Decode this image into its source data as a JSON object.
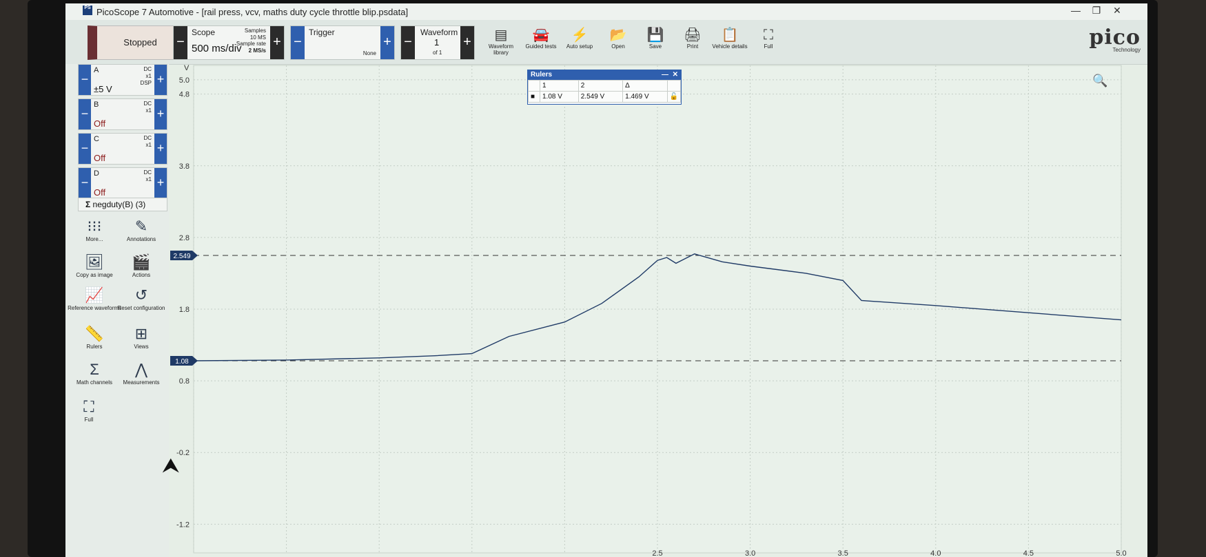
{
  "window": {
    "app_icon": "PS",
    "title": "PicoScope 7 Automotive - [rail press, vcv, maths duty cycle throttle blip.psdata]",
    "min_icon": "minimize-icon",
    "restore_icon": "restore-icon",
    "close_icon": "close-icon"
  },
  "toolbar": {
    "run_state": "Stopped",
    "scope": {
      "label": "Scope",
      "timebase": "500 ms/div",
      "samples_label": "Samples",
      "samples_value": "10 MS",
      "rate_label": "Sample rate",
      "rate_value": "2 MS/s"
    },
    "trigger": {
      "label": "Trigger",
      "mode": "None"
    },
    "waveform": {
      "label": "Waveform",
      "index": "1",
      "of": "of 1"
    },
    "buttons": [
      {
        "label": "Waveform library",
        "icon": "waveform-library-icon"
      },
      {
        "label": "Guided tests",
        "icon": "car-icon"
      },
      {
        "label": "Auto setup",
        "icon": "magic-wand-icon"
      },
      {
        "label": "Open",
        "icon": "folder-icon"
      },
      {
        "label": "Save",
        "icon": "save-icon"
      },
      {
        "label": "Print",
        "icon": "printer-icon"
      },
      {
        "label": "Vehicle details",
        "icon": "clipboard-icon"
      },
      {
        "label": "Full",
        "icon": "fullscreen-icon"
      }
    ],
    "brand": {
      "word": "pico",
      "sub": "Technology"
    }
  },
  "channels": [
    {
      "name": "A",
      "value": "±5 V",
      "coupling": "DC",
      "probe": "x1",
      "extra": "DSP",
      "color": "#111111"
    },
    {
      "name": "B",
      "value": "Off",
      "coupling": "DC",
      "probe": "x1",
      "extra": "",
      "color": "#8b1a1a"
    },
    {
      "name": "C",
      "value": "Off",
      "coupling": "DC",
      "probe": "x1",
      "extra": "",
      "color": "#8b1a1a"
    },
    {
      "name": "D",
      "value": "Off",
      "coupling": "DC",
      "probe": "x1",
      "extra": "",
      "color": "#8b1a1a"
    }
  ],
  "math_channel": {
    "symbol": "Σ",
    "label": "negduty(B) (3)"
  },
  "side_buttons": [
    {
      "label": "More...",
      "icon": "dots-grid-icon"
    },
    {
      "label": "Annotations",
      "icon": "annotations-icon"
    },
    {
      "label": "Copy as image",
      "icon": "image-icon"
    },
    {
      "label": "Actions",
      "icon": "clapperboard-icon"
    },
    {
      "label": "Reference waveforms",
      "icon": "reference-waveform-icon"
    },
    {
      "label": "Reset configuration",
      "icon": "reset-icon"
    },
    {
      "label": "Rulers",
      "icon": "ruler-icon"
    },
    {
      "label": "Views",
      "icon": "grid-view-icon"
    },
    {
      "label": "Math channels",
      "icon": "sigma-icon"
    },
    {
      "label": "Measurements",
      "icon": "calipers-icon"
    },
    {
      "label": "Full",
      "icon": "fullscreen-icon"
    }
  ],
  "rulers": {
    "title": "Rulers",
    "col1": "1",
    "col2": "2",
    "col3": "Δ",
    "v1": "1.08 V",
    "v2": "2.549 V",
    "delta": "1.469 V",
    "row_icon": "ruler-marker-icon",
    "lock_icon": "lock-icon"
  },
  "chart_data": {
    "type": "line",
    "ylabel": "V",
    "y_ticks": [
      "5.0",
      "4.8",
      "3.8",
      "2.8",
      "1.8",
      "0.8",
      "-0.2",
      "-1.2"
    ],
    "x_ticks": [
      "2.5",
      "3.0",
      "3.5",
      "4.0",
      "4.5",
      "5.0"
    ],
    "ylim": [
      -1.6,
      5.2
    ],
    "xlim": [
      0.0,
      5.0
    ],
    "ruler_levels": [
      {
        "label": "2.549",
        "value": 2.549
      },
      {
        "label": "1.08",
        "value": 1.08
      }
    ],
    "grid": true,
    "trace_color": "#1f3a66",
    "series": [
      {
        "x": [
          0.0,
          0.5,
          1.0,
          1.3,
          1.5,
          1.7,
          2.0,
          2.2,
          2.4,
          2.5,
          2.55,
          2.6,
          2.7,
          2.85,
          3.0,
          3.3,
          3.5,
          3.6,
          4.0,
          4.5,
          5.0
        ],
        "y": [
          1.08,
          1.09,
          1.12,
          1.15,
          1.18,
          1.42,
          1.62,
          1.88,
          2.25,
          2.48,
          2.52,
          2.44,
          2.57,
          2.46,
          2.4,
          2.3,
          2.2,
          1.92,
          1.85,
          1.75,
          1.65
        ]
      }
    ]
  },
  "zoom_icon": "zoom-icon",
  "cursor_icon": "mouse-pointer-icon"
}
